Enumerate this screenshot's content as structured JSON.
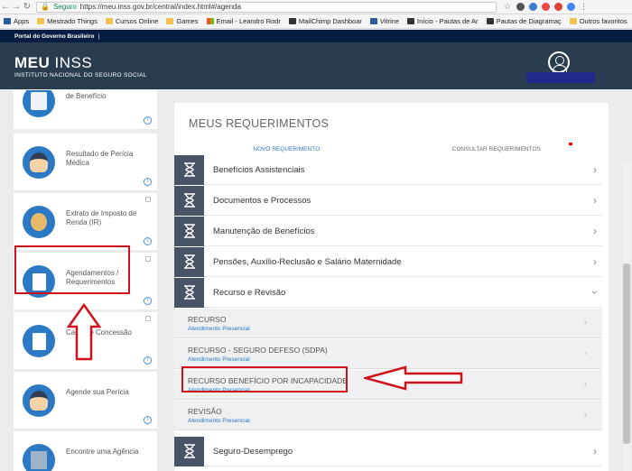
{
  "browser": {
    "secure_label": "Seguro",
    "url": "https://meu.inss.gov.br/central/index.html#/agenda",
    "bookmarks": [
      "Apps",
      "Mestrado Things",
      "Cursos Online",
      "Games",
      "Email - Leandro Rodr",
      "MailChimp Dashboar",
      "Vitrine",
      "Início - Pautas de Ar",
      "Pautas de Diagramaç"
    ],
    "other_bookmarks": "Outros favoritos"
  },
  "gov_bar": {
    "label": "Portal do Governo Brasileiro"
  },
  "header": {
    "logo_bold": "MEU",
    "logo_light": "INSS",
    "subtitle": "INSTITUTO NACIONAL DO SEGURO SOCIAL"
  },
  "sidebar": {
    "items": [
      {
        "label": "de Benefício"
      },
      {
        "label": "Resultado de Perícia Médica"
      },
      {
        "label": "Extrato de Imposto de Renda (IR)"
      },
      {
        "label": "Agendamentos / Requerimentos"
      },
      {
        "label": "Carta de Concessão"
      },
      {
        "label": "Agende sua Perícia"
      },
      {
        "label": "Encontre uma Agência"
      }
    ]
  },
  "main": {
    "title": "MEUS REQUERIMENTOS",
    "tabs": [
      {
        "label": "NOVO REQUERIMENTO",
        "active": true
      },
      {
        "label": "CONSULTAR REQUERIMENTOS",
        "active": false
      }
    ],
    "categories": [
      {
        "label": "Benefícios Assistenciais",
        "expanded": false
      },
      {
        "label": "Documentos e Processos",
        "expanded": false
      },
      {
        "label": "Manutenção de Benefícios",
        "expanded": false
      },
      {
        "label": "Pensões, Auxílio-Reclusão e Salário Maternidade",
        "expanded": false
      },
      {
        "label": "Recurso e Revisão",
        "expanded": true
      },
      {
        "label": "Seguro-Desemprego",
        "expanded": false
      }
    ],
    "sub_items": [
      {
        "title": "RECURSO",
        "subtitle": "Atendimento Presencial"
      },
      {
        "title": "RECURSO - SEGURO DEFESO (SDPA)",
        "subtitle": "Atendimento Presencial"
      },
      {
        "title": "RECURSO BENEFÍCIO POR INCAPACIDADE",
        "subtitle": "Atendimento Presencial"
      },
      {
        "title": "REVISÃO",
        "subtitle": "Atendimento Presencial"
      }
    ]
  },
  "colors": {
    "header": "#2a3c50",
    "gov_bar": "#071d41",
    "accent": "#2b78c5",
    "annotation": "#d0101b"
  }
}
